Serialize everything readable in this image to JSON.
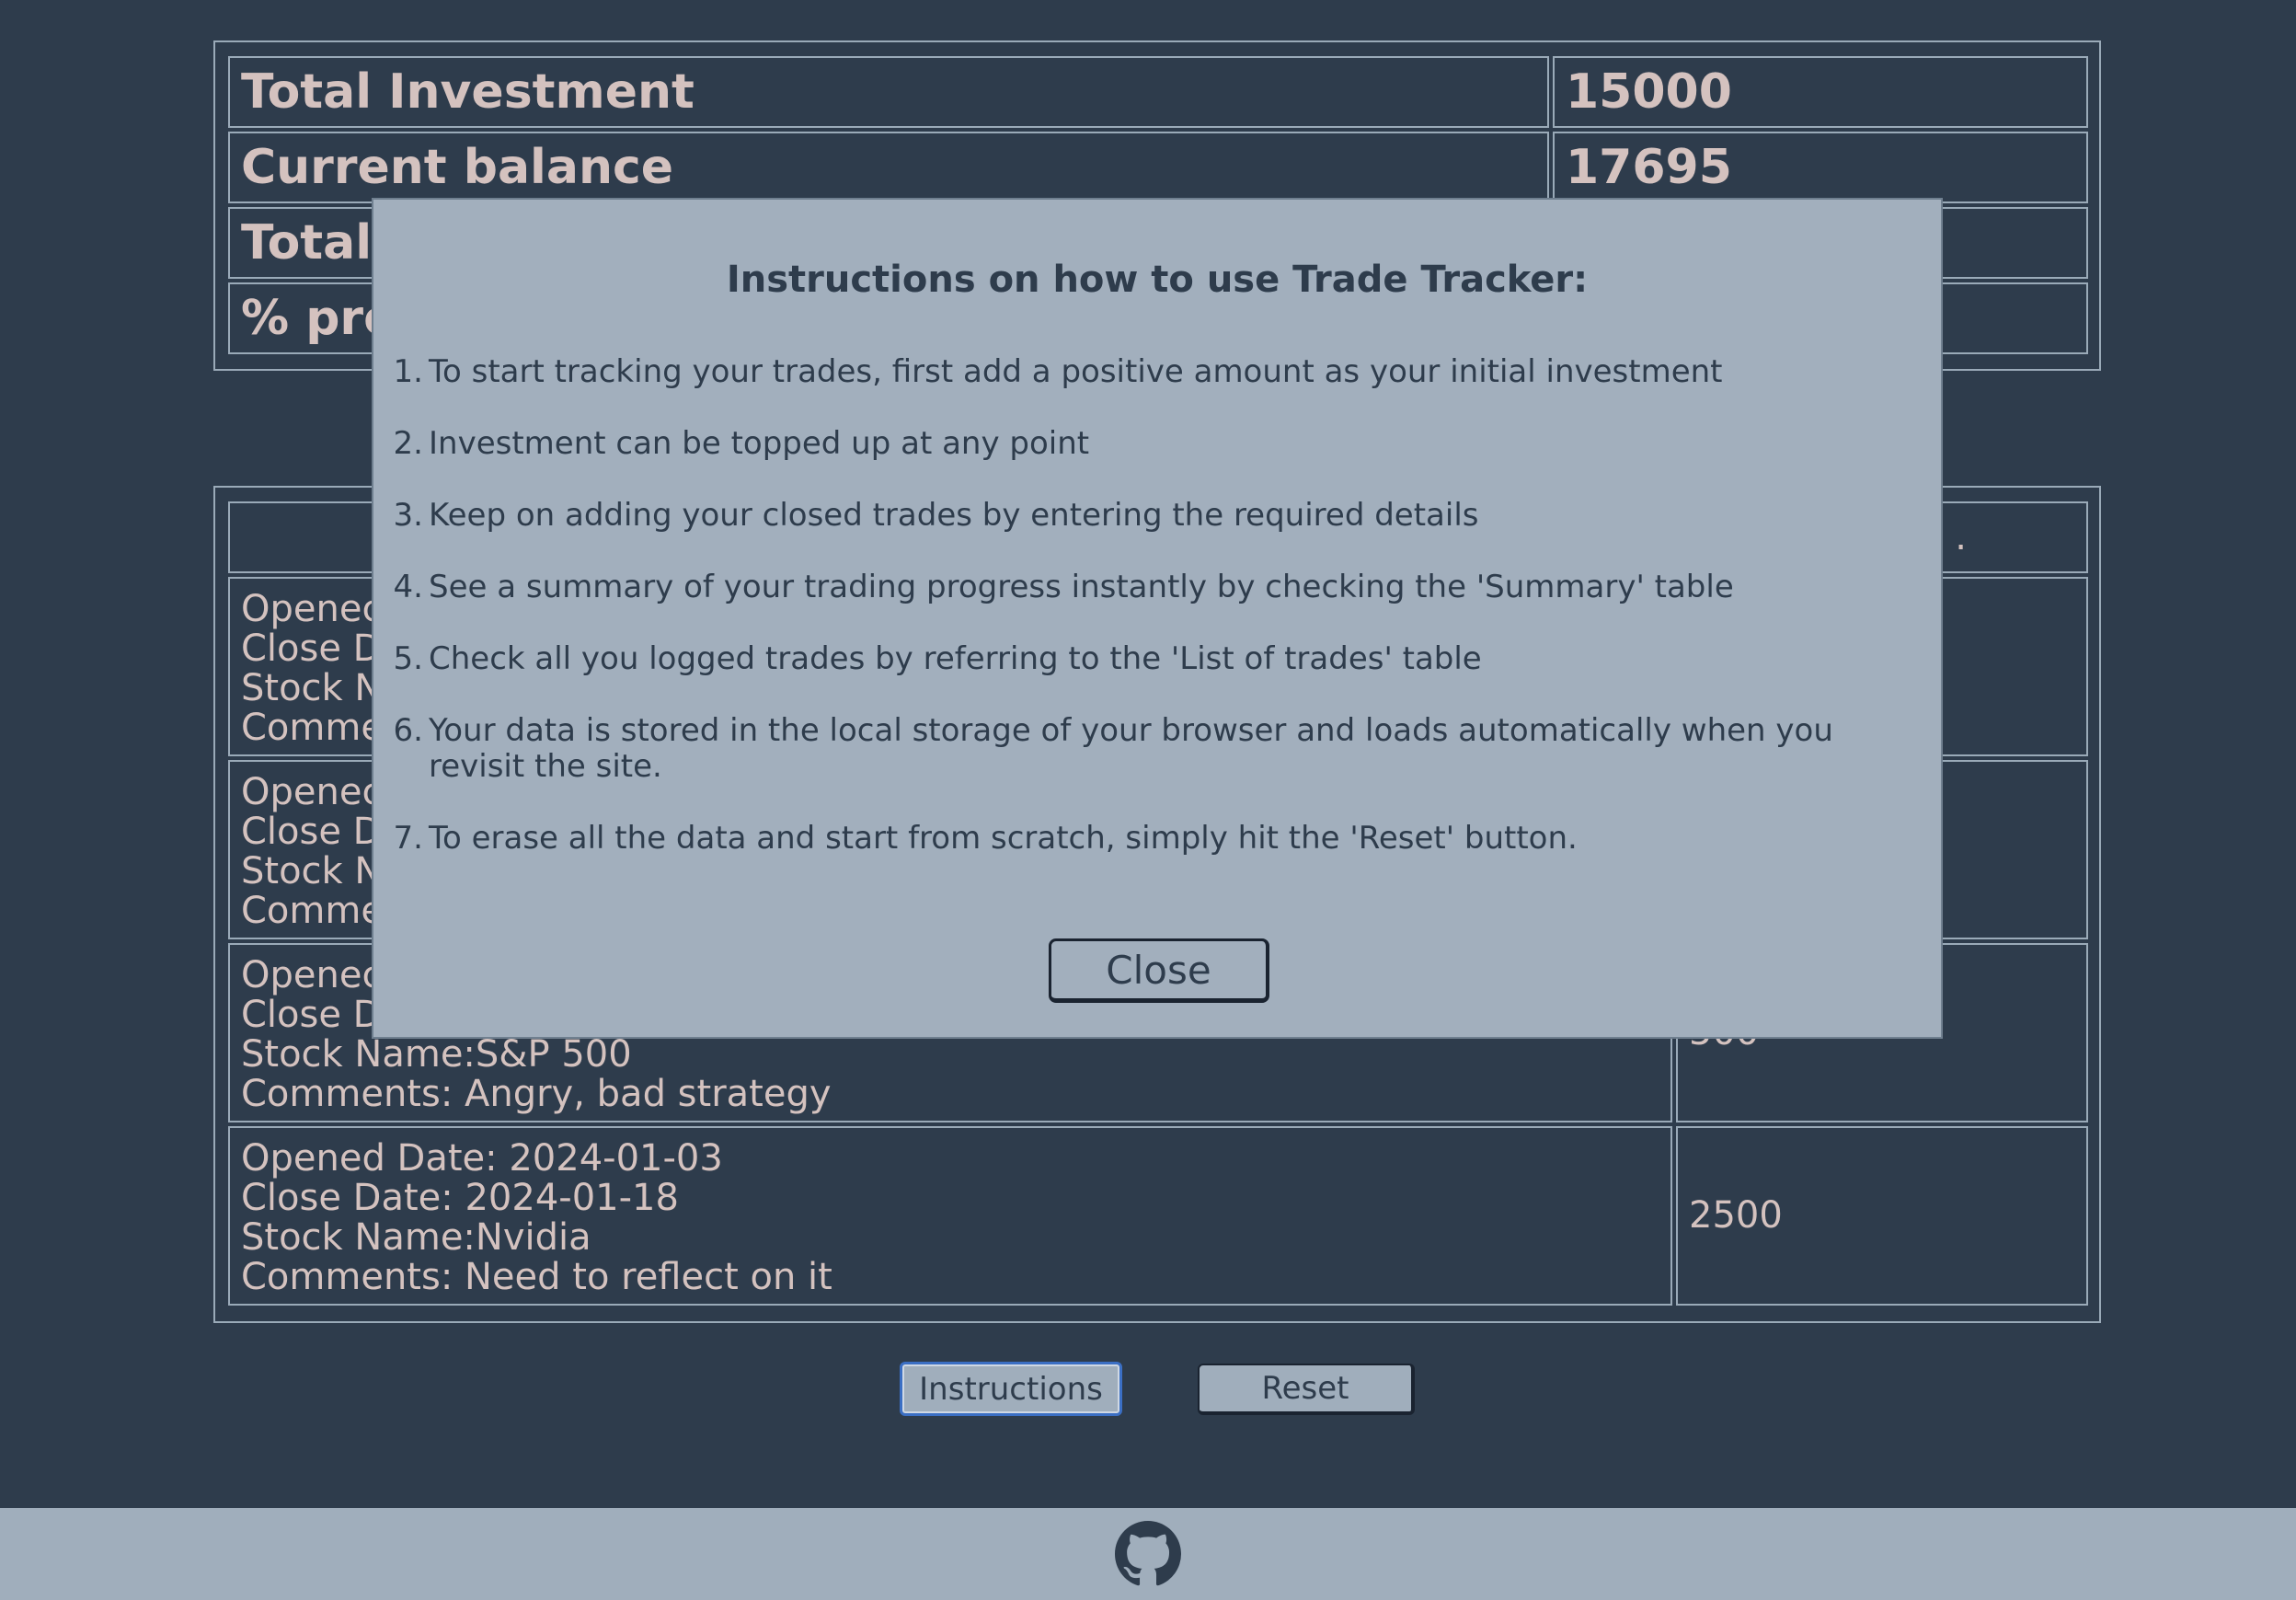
{
  "summary": {
    "rows": [
      {
        "label": "Total Investment",
        "value": "15000"
      },
      {
        "label": "Current balance",
        "value": "17695"
      },
      {
        "label": "Total ",
        "value": ""
      },
      {
        "label": "% pro",
        "value": ""
      }
    ]
  },
  "trades": {
    "header_partial": ".",
    "rows": [
      {
        "opened": "Openec",
        "close": "Close D",
        "stock": "Stock N",
        "comments": "Comme",
        "value": ""
      },
      {
        "opened": "Openec",
        "close": "Close D",
        "stock": "Stock N",
        "comments": "Comme",
        "value": ""
      },
      {
        "opened": "Openec",
        "close": "Close D",
        "stock": "Stock Name:S&P 500",
        "comments": "Comments: Angry, bad strategy",
        "value": "500"
      },
      {
        "opened": "Opened Date: 2024-01-03",
        "close": "Close Date: 2024-01-18",
        "stock": "Stock Name:Nvidia",
        "comments": "Comments: Need to reflect on it",
        "value": "2500"
      }
    ]
  },
  "buttons": {
    "instructions": "Instructions",
    "reset": "Reset"
  },
  "footer": {
    "icon": "github-icon"
  },
  "modal": {
    "title": "Instructions on how to use Trade Tracker:",
    "items": [
      {
        "num": "1.",
        "text": "To start tracking your trades, first add a positive amount as your initial investment"
      },
      {
        "num": "2.",
        "text": "Investment can be topped up at any point"
      },
      {
        "num": "3.",
        "text": "Keep on adding your closed trades by entering the required details"
      },
      {
        "num": "4.",
        "text": "See a summary of your trading progress instantly by checking the 'Summary' table"
      },
      {
        "num": "5.",
        "text": "Check all you logged trades by referring to the 'List of trades' table"
      },
      {
        "num": "6.",
        "text": "Your data is stored in the local storage of your browser and loads automatically when you revisit the site."
      },
      {
        "num": "7.",
        "text": "To erase all the data and start from scratch, simply hit the 'Reset' button."
      }
    ],
    "close_label": "Close"
  },
  "colors": {
    "background": "#2e3c4c",
    "modal": "#a2afbd",
    "text": "#d4c2bf"
  }
}
